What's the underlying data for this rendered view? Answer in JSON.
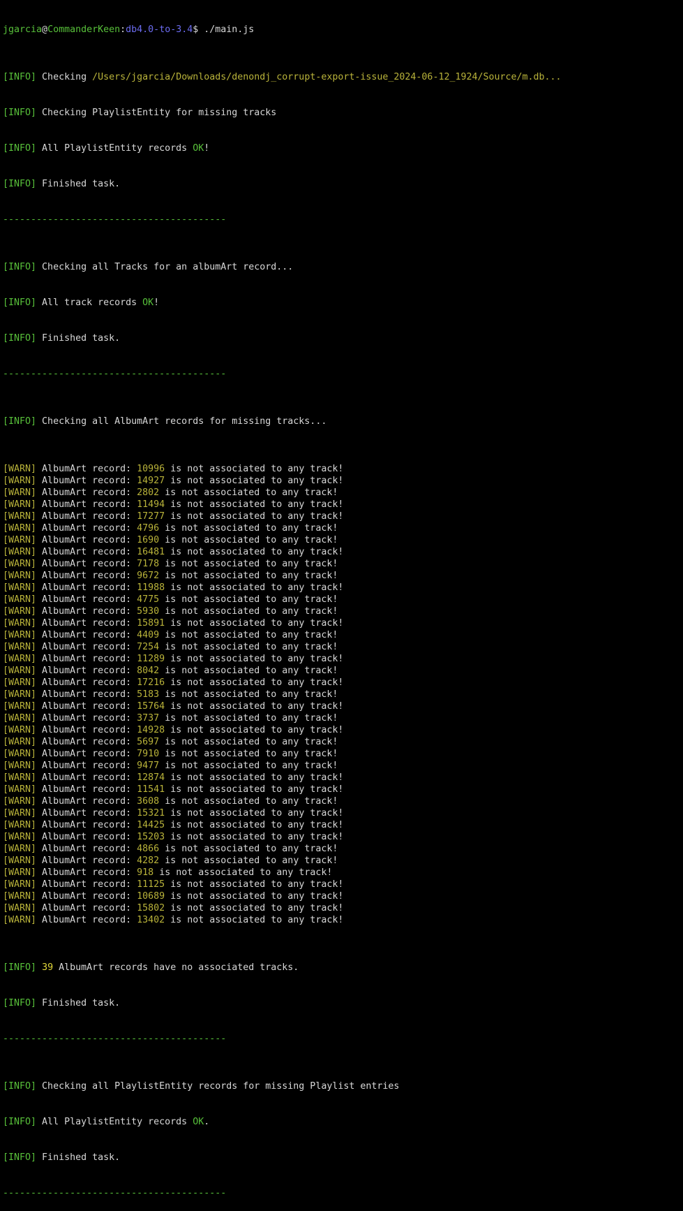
{
  "prompt": {
    "user": "jgarcia",
    "at": "@",
    "host": "CommanderKeen",
    "colon": ":",
    "dir": "db4.0-to-3.4",
    "dollar": "$ ",
    "command": "./main.js"
  },
  "tags": {
    "info": "[INFO]",
    "warn": "[WARN]"
  },
  "separator": "----------------------------------------",
  "section1": {
    "checking_prefix": " Checking ",
    "path": "/Users/jgarcia/Downloads/denondj_corrupt-export-issue_2024-06-12_1924/Source/m.db...",
    "line2": " Checking PlaylistEntity for missing tracks",
    "line3_pre": " All PlaylistEntity records ",
    "line3_ok": "OK",
    "line3_post": "!",
    "line4": " Finished task."
  },
  "section2": {
    "line1": " Checking all Tracks for an albumArt record...",
    "line2_pre": " All track records ",
    "line2_ok": "OK",
    "line2_post": "!",
    "line3": " Finished task."
  },
  "section3": {
    "line1": " Checking all AlbumArt records for missing tracks...",
    "warn_prefix": " AlbumArt record: ",
    "warn_suffix": " is not associated to any track!",
    "records": [
      "10996",
      "14927",
      "2802",
      "11494",
      "17277",
      "4796",
      "1690",
      "16481",
      "7178",
      "9672",
      "11988",
      "4775",
      "5930",
      "15891",
      "4409",
      "7254",
      "11289",
      "8042",
      "17216",
      "5183",
      "15764",
      "3737",
      "14928",
      "5697",
      "7910",
      "9477",
      "12874",
      "11541",
      "3608",
      "15321",
      "14425",
      "15203",
      "4866",
      "4282",
      "918",
      "11125",
      "10689",
      "15802",
      "13402"
    ],
    "summary_count": "39",
    "summary_text": " AlbumArt records have no associated tracks.",
    "finished": " Finished task."
  },
  "section4": {
    "line1": " Checking all PlaylistEntity records for missing Playlist entries",
    "line2_pre": " All PlaylistEntity records ",
    "line2_ok": "OK",
    "line2_post": ".",
    "line3": " Finished task."
  }
}
